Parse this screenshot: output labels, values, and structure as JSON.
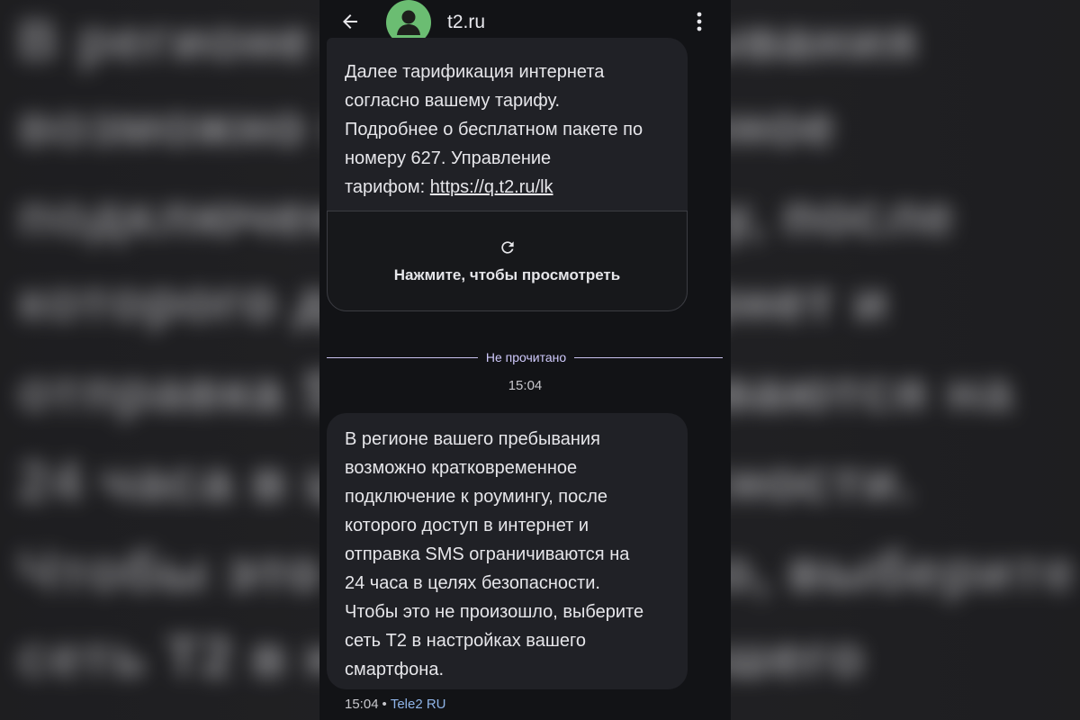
{
  "header": {
    "back_icon": "arrow-left-icon",
    "avatar_icon": "person-icon",
    "contact_name": "t2.ru",
    "more_icon": "more-vertical-icon"
  },
  "messages": {
    "first": {
      "text_lines": [
        "Далее тарификация интернета",
        "согласно вашему тарифу.",
        "Подробнее о бесплатном пакете по",
        "номеру 627. Управление"
      ],
      "last_line_prefix": "тарифом: ",
      "link_text": "https://q.t2.ru/lk",
      "preview": {
        "icon": "refresh-icon",
        "label": "Нажмите, чтобы просмотреть"
      }
    },
    "unread_divider": "Не прочитано",
    "timestamp": "15:04",
    "second": {
      "text_lines": [
        "В регионе вашего пребывания",
        "возможно кратковременное",
        "подключение к роумингу, после",
        "которого доступ в интернет и",
        "отправка SMS ограничиваются на",
        "24 часа в целях безопасности.",
        "Чтобы это не произошло, выберите",
        "сеть Т2 в настройках вашего",
        "смартфона."
      ],
      "time": "15:04",
      "separator": "•",
      "sender": "Tele2 RU"
    }
  },
  "colors": {
    "avatar": "#6bbd72",
    "bubble": "#202126",
    "divider": "#c9c1ef",
    "sender": "#8fb4e8"
  }
}
